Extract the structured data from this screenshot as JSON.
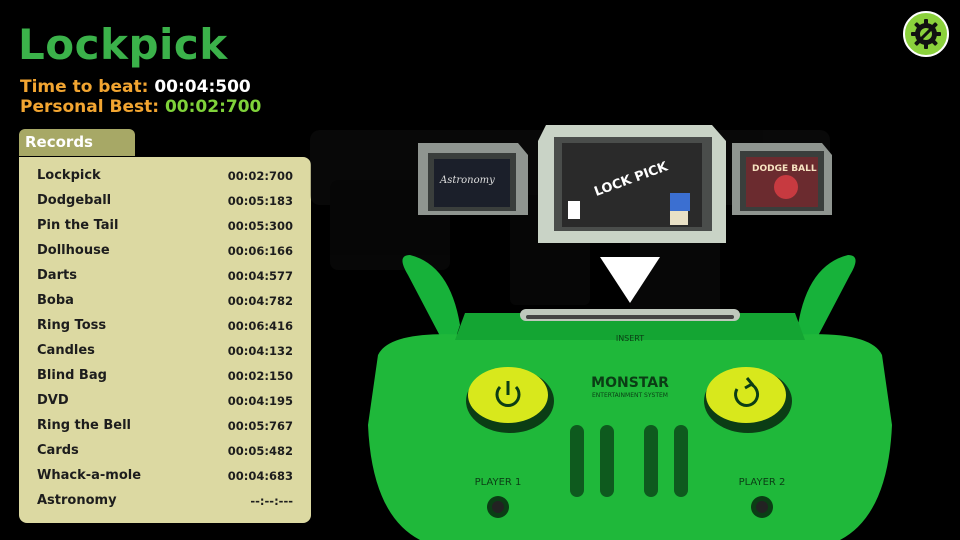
{
  "game": {
    "title": "Lockpick",
    "time_to_beat_label": "Time to beat:",
    "time_to_beat_value": "00:04:500",
    "personal_best_label": "Personal Best:",
    "personal_best_value": "00:02:700"
  },
  "records": {
    "tab_label": "Records",
    "items": [
      {
        "name": "Lockpick",
        "time": "00:02:700"
      },
      {
        "name": "Dodgeball",
        "time": "00:05:183"
      },
      {
        "name": "Pin the Tail",
        "time": "00:05:300"
      },
      {
        "name": "Dollhouse",
        "time": "00:06:166"
      },
      {
        "name": "Darts",
        "time": "00:04:577"
      },
      {
        "name": "Boba",
        "time": "00:04:782"
      },
      {
        "name": "Ring Toss",
        "time": "00:06:416"
      },
      {
        "name": "Candles",
        "time": "00:04:132"
      },
      {
        "name": "Blind Bag",
        "time": "00:02:150"
      },
      {
        "name": "DVD",
        "time": "00:04:195"
      },
      {
        "name": "Ring the Bell",
        "time": "00:05:767"
      },
      {
        "name": "Cards",
        "time": "00:05:482"
      },
      {
        "name": "Whack-a-mole",
        "time": "00:04:683"
      },
      {
        "name": "Astronomy",
        "time": "--:--:---"
      }
    ]
  },
  "console": {
    "insert_label": "INSERT",
    "brand": "MONSTAR",
    "brand_sub": "ENTERTAINMENT SYSTEM",
    "player1_label": "PLAYER 1",
    "player2_label": "PLAYER 2"
  },
  "cartridges": {
    "left_label": "Astronomy",
    "center_label": "LOCK PICK",
    "right_label": "DODGE BALL"
  },
  "colors": {
    "title_green": "#3bb24a",
    "label_orange": "#f2a531",
    "best_green": "#7fd23a",
    "panel": "#dcd9a2",
    "tab": "#a7a866",
    "console_green": "#1fb83a",
    "button_yellow": "#d8e81c"
  },
  "icons": {
    "settings": "gear-wrench-icon",
    "power": "power-icon",
    "reset": "reset-icon"
  }
}
